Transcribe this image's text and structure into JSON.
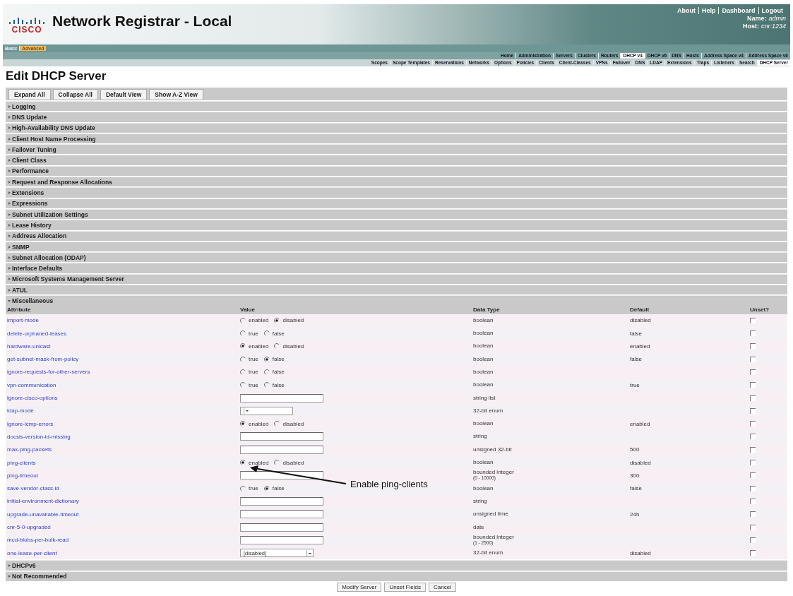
{
  "header": {
    "logo": "CISCO",
    "title": "Network Registrar - Local",
    "links": [
      "About",
      "Help",
      "Dashboard",
      "Logout"
    ],
    "user": {
      "label": "Name:",
      "value": "admin"
    },
    "host": {
      "label": "Host:",
      "value": "cnr:1234"
    }
  },
  "modes": [
    {
      "label": "Basic",
      "selected": false
    },
    {
      "label": "Advanced",
      "selected": true
    }
  ],
  "main_nav": [
    {
      "label": "Home",
      "selected": false
    },
    {
      "label": "Administration",
      "selected": false
    },
    {
      "label": "Servers",
      "selected": false
    },
    {
      "label": "Clusters",
      "selected": false
    },
    {
      "label": "Routers",
      "selected": false
    },
    {
      "label": "DHCP v4",
      "selected": true
    },
    {
      "label": "DHCP v6",
      "selected": false
    },
    {
      "label": "DNS",
      "selected": false
    },
    {
      "label": "Hosts",
      "selected": false
    },
    {
      "label": "Address Space v4",
      "selected": false
    },
    {
      "label": "Address Space v6",
      "selected": false
    }
  ],
  "sub_nav": [
    {
      "label": "Scopes",
      "selected": false
    },
    {
      "label": "Scope Templates",
      "selected": false
    },
    {
      "label": "Reservations",
      "selected": false
    },
    {
      "label": "Networks",
      "selected": false
    },
    {
      "label": "Options",
      "selected": false
    },
    {
      "label": "Policies",
      "selected": false
    },
    {
      "label": "Clients",
      "selected": false
    },
    {
      "label": "Client-Classes",
      "selected": false
    },
    {
      "label": "VPNs",
      "selected": false
    },
    {
      "label": "Failover",
      "selected": false
    },
    {
      "label": "DNS",
      "selected": false
    },
    {
      "label": "LDAP",
      "selected": false
    },
    {
      "label": "Extensions",
      "selected": false
    },
    {
      "label": "Traps",
      "selected": false
    },
    {
      "label": "Listeners",
      "selected": false
    },
    {
      "label": "Search",
      "selected": false
    },
    {
      "label": "DHCP Server",
      "selected": true
    }
  ],
  "page_title": "Edit DHCP Server",
  "toolbar": [
    "Expand All",
    "Collapse All",
    "Default View",
    "Show A-Z View"
  ],
  "sections": [
    {
      "label": "Logging",
      "expanded": false
    },
    {
      "label": "DNS Update",
      "expanded": false
    },
    {
      "label": "High-Availability DNS Update",
      "expanded": false
    },
    {
      "label": "Client Host Name Processing",
      "expanded": false
    },
    {
      "label": "Failover Tuning",
      "expanded": false
    },
    {
      "label": "Client Class",
      "expanded": false
    },
    {
      "label": "Performance",
      "expanded": false
    },
    {
      "label": "Request and Response Allocations",
      "expanded": false
    },
    {
      "label": "Extensions",
      "expanded": false
    },
    {
      "label": "Expressions",
      "expanded": false
    },
    {
      "label": "Subnet Utilization Settings",
      "expanded": false
    },
    {
      "label": "Lease History",
      "expanded": false
    },
    {
      "label": "Address Allocation",
      "expanded": false
    },
    {
      "label": "SNMP",
      "expanded": false
    },
    {
      "label": "Subnet Allocation (ODAP)",
      "expanded": false
    },
    {
      "label": "Interface Defaults",
      "expanded": false
    },
    {
      "label": "Microsoft Systems Management Server",
      "expanded": false
    },
    {
      "label": "ATUL",
      "expanded": false
    },
    {
      "label": "Miscellaneous",
      "expanded": true
    }
  ],
  "table": {
    "columns": [
      "Attribute",
      "Value",
      "Data Type",
      "Default",
      "Unset?"
    ],
    "rows": [
      {
        "attribute": "import-mode",
        "value": {
          "kind": "radio",
          "options": [
            {
              "label": "enabled",
              "selected": false
            },
            {
              "label": "disabled",
              "selected": true
            }
          ]
        },
        "type": "boolean",
        "default": "disabled",
        "unset": false
      },
      {
        "attribute": "delete-orphaned-leases",
        "value": {
          "kind": "radio",
          "options": [
            {
              "label": "true",
              "selected": false
            },
            {
              "label": "false",
              "selected": false
            }
          ]
        },
        "type": "boolean",
        "default": "false",
        "unset": false
      },
      {
        "attribute": "hardware-unicast",
        "value": {
          "kind": "radio",
          "options": [
            {
              "label": "enabled",
              "selected": true
            },
            {
              "label": "disabled",
              "selected": false
            }
          ]
        },
        "type": "boolean",
        "default": "enabled",
        "unset": false
      },
      {
        "attribute": "get-subnet-mask-from-policy",
        "value": {
          "kind": "radio",
          "options": [
            {
              "label": "true",
              "selected": false
            },
            {
              "label": "false",
              "selected": true
            }
          ]
        },
        "type": "boolean",
        "default": "false",
        "unset": false
      },
      {
        "attribute": "ignore-requests-for-other-servers",
        "value": {
          "kind": "radio",
          "options": [
            {
              "label": "true",
              "selected": false
            },
            {
              "label": "false",
              "selected": false
            }
          ]
        },
        "type": "boolean",
        "unset": false
      },
      {
        "attribute": "vpn-communication",
        "value": {
          "kind": "radio",
          "options": [
            {
              "label": "true",
              "selected": false
            },
            {
              "label": "false",
              "selected": false
            }
          ]
        },
        "type": "boolean",
        "default": "true",
        "unset": false
      },
      {
        "attribute": "ignore-cisco-options",
        "value": {
          "kind": "text"
        },
        "type": "string list",
        "unset": false
      },
      {
        "attribute": "ldap-mode",
        "value": {
          "kind": "select"
        },
        "type": "32-bit enum",
        "unset": false
      },
      {
        "attribute": "ignore-icmp-errors",
        "value": {
          "kind": "radio",
          "options": [
            {
              "label": "enabled",
              "selected": true
            },
            {
              "label": "disabled",
              "selected": false
            }
          ]
        },
        "type": "boolean",
        "default": "enabled",
        "unset": false
      },
      {
        "attribute": "docsis-version-id-missing",
        "value": {
          "kind": "text"
        },
        "type": "string",
        "unset": false
      },
      {
        "attribute": "max-ping-packets",
        "value": {
          "kind": "text"
        },
        "type": "unsigned 32-bit",
        "default": "500",
        "unset": false
      },
      {
        "attribute": "ping-clients",
        "value": {
          "kind": "radio",
          "options": [
            {
              "label": "enabled",
              "selected": true
            },
            {
              "label": "disabled",
              "selected": false
            }
          ]
        },
        "type": "boolean",
        "default": "disabled",
        "unset": false
      },
      {
        "attribute": "ping-timeout",
        "value": {
          "kind": "text"
        },
        "type": "bounded integer",
        "range": "(0 - 10000)",
        "default": "300",
        "unset": false
      },
      {
        "attribute": "save-vendor-class-id",
        "value": {
          "kind": "radio",
          "options": [
            {
              "label": "true",
              "selected": false
            },
            {
              "label": "false",
              "selected": true
            }
          ]
        },
        "type": "boolean",
        "default": "false",
        "unset": false
      },
      {
        "attribute": "initial-environment-dictionary",
        "value": {
          "kind": "text"
        },
        "type": "string",
        "unset": false
      },
      {
        "attribute": "upgrade-unavailable-timeout",
        "value": {
          "kind": "text"
        },
        "type": "unsigned time",
        "default": "24h",
        "unset": false
      },
      {
        "attribute": "cnr-5-0-upgraded",
        "value": {
          "kind": "text"
        },
        "type": "date",
        "unset": false
      },
      {
        "attribute": "mcd-blobs-per-bulk-read",
        "value": {
          "kind": "text"
        },
        "type": "bounded integer",
        "range": "(1 - 2500)",
        "unset": false
      },
      {
        "attribute": "one-lease-per-client",
        "value": {
          "kind": "select",
          "text": "[disabled]"
        },
        "type": "32-bit enum",
        "default": "disabled",
        "unset": false
      }
    ]
  },
  "more_sections": [
    {
      "label": "DHCPv6",
      "expanded": false
    },
    {
      "label": "Not Recommended",
      "expanded": false
    }
  ],
  "annotation": "Enable ping-clients",
  "actions": [
    "Modify Server",
    "Unset Fields",
    "Cancel"
  ]
}
